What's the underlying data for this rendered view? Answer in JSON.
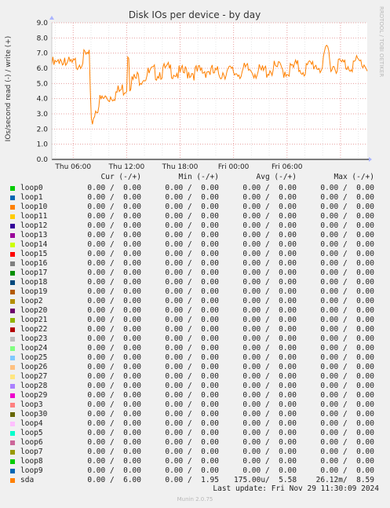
{
  "chart_data": {
    "type": "line",
    "title": "Disk IOs per device - by day",
    "ylabel": "IOs/second read (-) / write (+)",
    "ylim": [
      0,
      9.0
    ],
    "yticks": [
      "0.0",
      "1.0",
      "2.0",
      "3.0",
      "4.0",
      "5.0",
      "6.0",
      "7.0",
      "8.0",
      "9.0"
    ],
    "xticks": [
      "Thu 06:00",
      "Thu 12:00",
      "Thu 18:00",
      "Fri 00:00",
      "Fri 06:00"
    ],
    "grid": true,
    "series": [
      {
        "name": "sda",
        "color": "#ff8000",
        "x_hours": [
          0,
          0.5,
          1,
          1.5,
          1.8,
          2.0,
          2.1,
          2.5,
          3,
          3.5,
          4,
          4.5,
          5,
          5.5,
          6,
          6.2,
          6.3,
          6.5,
          7,
          7.5,
          8,
          9,
          10,
          11,
          12,
          13,
          14,
          15,
          16,
          17,
          18,
          19,
          20,
          21,
          22,
          23,
          24,
          25,
          26,
          27,
          28,
          28.5,
          29,
          30,
          31,
          32,
          32.5,
          33
        ],
        "values": [
          6.2,
          6.4,
          6.6,
          6.8,
          6.9,
          2.0,
          2.5,
          3.2,
          3.8,
          4.0,
          4.1,
          4.3,
          4.4,
          4.6,
          4.8,
          8.5,
          5.0,
          5.1,
          5.3,
          5.4,
          5.5,
          5.7,
          5.8,
          5.9,
          5.6,
          5.8,
          5.7,
          5.9,
          5.6,
          5.8,
          5.7,
          5.8,
          5.9,
          5.7,
          5.9,
          6.0,
          5.8,
          6.1,
          5.9,
          6.3,
          6.0,
          7.5,
          6.1,
          6.3,
          6.2,
          6.4,
          6.3,
          6.2
        ]
      }
    ]
  },
  "side_text": "RRDTOOL / TOBI OETIKER",
  "legend": {
    "headers": [
      "Cur (-/+)",
      "Min (-/+)",
      "Avg (-/+)",
      "Max (-/+)"
    ],
    "rows": [
      {
        "name": "loop0",
        "color": "#00cc00",
        "cur": "0.00 /  0.00",
        "min": "0.00 /  0.00",
        "avg": "0.00 /  0.00",
        "max": "0.00 /  0.00"
      },
      {
        "name": "loop1",
        "color": "#0066b3",
        "cur": "0.00 /  0.00",
        "min": "0.00 /  0.00",
        "avg": "0.00 /  0.00",
        "max": "0.00 /  0.00"
      },
      {
        "name": "loop10",
        "color": "#ff8000",
        "cur": "0.00 /  0.00",
        "min": "0.00 /  0.00",
        "avg": "0.00 /  0.00",
        "max": "0.00 /  0.00"
      },
      {
        "name": "loop11",
        "color": "#ffcc00",
        "cur": "0.00 /  0.00",
        "min": "0.00 /  0.00",
        "avg": "0.00 /  0.00",
        "max": "0.00 /  0.00"
      },
      {
        "name": "loop12",
        "color": "#330099",
        "cur": "0.00 /  0.00",
        "min": "0.00 /  0.00",
        "avg": "0.00 /  0.00",
        "max": "0.00 /  0.00"
      },
      {
        "name": "loop13",
        "color": "#990099",
        "cur": "0.00 /  0.00",
        "min": "0.00 /  0.00",
        "avg": "0.00 /  0.00",
        "max": "0.00 /  0.00"
      },
      {
        "name": "loop14",
        "color": "#ccff00",
        "cur": "0.00 /  0.00",
        "min": "0.00 /  0.00",
        "avg": "0.00 /  0.00",
        "max": "0.00 /  0.00"
      },
      {
        "name": "loop15",
        "color": "#ff0000",
        "cur": "0.00 /  0.00",
        "min": "0.00 /  0.00",
        "avg": "0.00 /  0.00",
        "max": "0.00 /  0.00"
      },
      {
        "name": "loop16",
        "color": "#808080",
        "cur": "0.00 /  0.00",
        "min": "0.00 /  0.00",
        "avg": "0.00 /  0.00",
        "max": "0.00 /  0.00"
      },
      {
        "name": "loop17",
        "color": "#008f00",
        "cur": "0.00 /  0.00",
        "min": "0.00 /  0.00",
        "avg": "0.00 /  0.00",
        "max": "0.00 /  0.00"
      },
      {
        "name": "loop18",
        "color": "#00487d",
        "cur": "0.00 /  0.00",
        "min": "0.00 /  0.00",
        "avg": "0.00 /  0.00",
        "max": "0.00 /  0.00"
      },
      {
        "name": "loop19",
        "color": "#b35a00",
        "cur": "0.00 /  0.00",
        "min": "0.00 /  0.00",
        "avg": "0.00 /  0.00",
        "max": "0.00 /  0.00"
      },
      {
        "name": "loop2",
        "color": "#b38f00",
        "cur": "0.00 /  0.00",
        "min": "0.00 /  0.00",
        "avg": "0.00 /  0.00",
        "max": "0.00 /  0.00"
      },
      {
        "name": "loop20",
        "color": "#6b006b",
        "cur": "0.00 /  0.00",
        "min": "0.00 /  0.00",
        "avg": "0.00 /  0.00",
        "max": "0.00 /  0.00"
      },
      {
        "name": "loop21",
        "color": "#8fb300",
        "cur": "0.00 /  0.00",
        "min": "0.00 /  0.00",
        "avg": "0.00 /  0.00",
        "max": "0.00 /  0.00"
      },
      {
        "name": "loop22",
        "color": "#b30000",
        "cur": "0.00 /  0.00",
        "min": "0.00 /  0.00",
        "avg": "0.00 /  0.00",
        "max": "0.00 /  0.00"
      },
      {
        "name": "loop23",
        "color": "#bebebe",
        "cur": "0.00 /  0.00",
        "min": "0.00 /  0.00",
        "avg": "0.00 /  0.00",
        "max": "0.00 /  0.00"
      },
      {
        "name": "loop24",
        "color": "#80ff80",
        "cur": "0.00 /  0.00",
        "min": "0.00 /  0.00",
        "avg": "0.00 /  0.00",
        "max": "0.00 /  0.00"
      },
      {
        "name": "loop25",
        "color": "#80c9ff",
        "cur": "0.00 /  0.00",
        "min": "0.00 /  0.00",
        "avg": "0.00 /  0.00",
        "max": "0.00 /  0.00"
      },
      {
        "name": "loop26",
        "color": "#ffc080",
        "cur": "0.00 /  0.00",
        "min": "0.00 /  0.00",
        "avg": "0.00 /  0.00",
        "max": "0.00 /  0.00"
      },
      {
        "name": "loop27",
        "color": "#ffe680",
        "cur": "0.00 /  0.00",
        "min": "0.00 /  0.00",
        "avg": "0.00 /  0.00",
        "max": "0.00 /  0.00"
      },
      {
        "name": "loop28",
        "color": "#aa80ff",
        "cur": "0.00 /  0.00",
        "min": "0.00 /  0.00",
        "avg": "0.00 /  0.00",
        "max": "0.00 /  0.00"
      },
      {
        "name": "loop29",
        "color": "#ee00cc",
        "cur": "0.00 /  0.00",
        "min": "0.00 /  0.00",
        "avg": "0.00 /  0.00",
        "max": "0.00 /  0.00"
      },
      {
        "name": "loop3",
        "color": "#ff8080",
        "cur": "0.00 /  0.00",
        "min": "0.00 /  0.00",
        "avg": "0.00 /  0.00",
        "max": "0.00 /  0.00"
      },
      {
        "name": "loop30",
        "color": "#666600",
        "cur": "0.00 /  0.00",
        "min": "0.00 /  0.00",
        "avg": "0.00 /  0.00",
        "max": "0.00 /  0.00"
      },
      {
        "name": "loop4",
        "color": "#ffbfff",
        "cur": "0.00 /  0.00",
        "min": "0.00 /  0.00",
        "avg": "0.00 /  0.00",
        "max": "0.00 /  0.00"
      },
      {
        "name": "loop5",
        "color": "#00ffcc",
        "cur": "0.00 /  0.00",
        "min": "0.00 /  0.00",
        "avg": "0.00 /  0.00",
        "max": "0.00 /  0.00"
      },
      {
        "name": "loop6",
        "color": "#cc6699",
        "cur": "0.00 /  0.00",
        "min": "0.00 /  0.00",
        "avg": "0.00 /  0.00",
        "max": "0.00 /  0.00"
      },
      {
        "name": "loop7",
        "color": "#999900",
        "cur": "0.00 /  0.00",
        "min": "0.00 /  0.00",
        "avg": "0.00 /  0.00",
        "max": "0.00 /  0.00"
      },
      {
        "name": "loop8",
        "color": "#00cc00",
        "cur": "0.00 /  0.00",
        "min": "0.00 /  0.00",
        "avg": "0.00 /  0.00",
        "max": "0.00 /  0.00"
      },
      {
        "name": "loop9",
        "color": "#0066b3",
        "cur": "0.00 /  0.00",
        "min": "0.00 /  0.00",
        "avg": "0.00 /  0.00",
        "max": "0.00 /  0.00"
      },
      {
        "name": "sda",
        "color": "#ff8000",
        "cur": "0.00 /  6.00",
        "min": "0.00 /  1.95",
        "avg": "175.00u/  5.58",
        "max": "26.12m/  8.59"
      }
    ]
  },
  "footer": {
    "last_update": "Last update: Fri Nov 29 11:30:09 2024",
    "munin": "Munin 2.0.75"
  }
}
